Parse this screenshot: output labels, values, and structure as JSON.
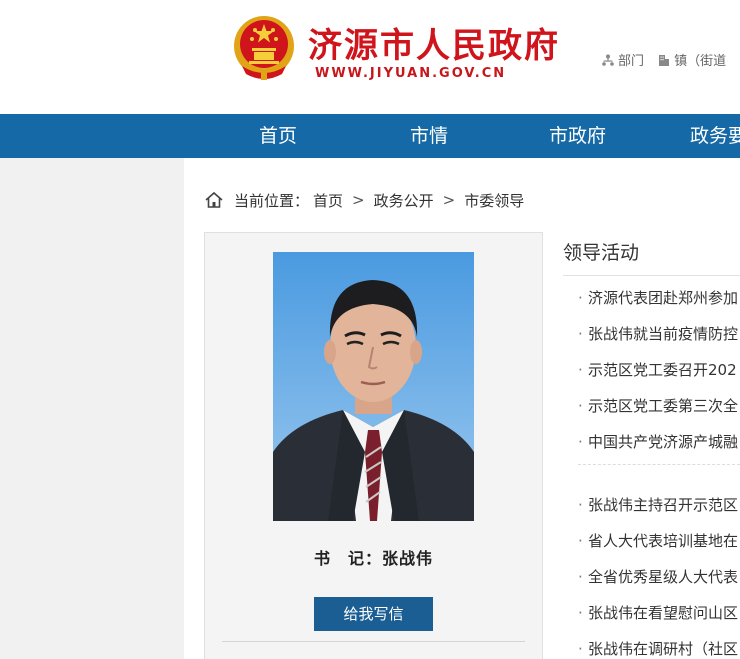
{
  "header": {
    "site_title": "济源市人民政府",
    "site_url": "WWW.JIYUAN.GOV.CN",
    "links": [
      {
        "label": "部门",
        "icon": "org-chart-icon"
      },
      {
        "label": "镇（街道",
        "icon": "building-icon"
      }
    ]
  },
  "nav": {
    "items": [
      "首页",
      "市情",
      "市政府",
      "政务要"
    ]
  },
  "breadcrumb": {
    "prefix": "当前位置：",
    "items": [
      "首页",
      "政务公开",
      "市委领导"
    ],
    "separator": ">"
  },
  "profile": {
    "name": "书　记：张战伟",
    "write_button": "给我写信"
  },
  "activities": {
    "title": "领导活动",
    "items_top": [
      "济源代表团赴郑州参加",
      "张战伟就当前疫情防控",
      "示范区党工委召开202",
      "示范区党工委第三次全",
      "中国共产党济源产城融"
    ],
    "items_bottom": [
      "张战伟主持召开示范区",
      "省人大代表培训基地在",
      "全省优秀星级人大代表",
      "张战伟在看望慰问山区",
      "张战伟在调研村（社区"
    ]
  },
  "colors": {
    "nav_bg": "#1469a6",
    "title_red": "#d0141c",
    "button_blue": "#1b5e94"
  }
}
